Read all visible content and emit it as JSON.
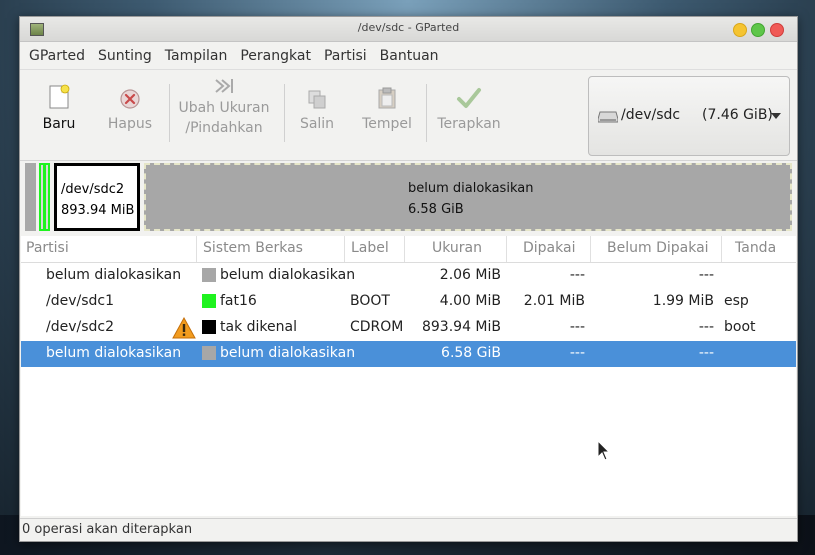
{
  "window": {
    "title": "/dev/sdc - GParted"
  },
  "menu": [
    "GParted",
    "Sunting",
    "Tampilan",
    "Perangkat",
    "Partisi",
    "Bantuan"
  ],
  "toolbar": {
    "new": "Baru",
    "delete": "Hapus",
    "resize_line1": "Ubah Ukuran",
    "resize_line2": "/Pindahkan",
    "copy": "Salin",
    "paste": "Tempel",
    "apply": "Terapkan"
  },
  "device": {
    "name": "/dev/sdc",
    "size": "(7.46 GiB)"
  },
  "diskmap": {
    "sdc2_name": "/dev/sdc2",
    "sdc2_size": "893.94 MiB",
    "unalloc_label": "belum dialokasikan",
    "unalloc_size": "6.58 GiB"
  },
  "columns": [
    "Partisi",
    "Sistem Berkas",
    "Label",
    "Ukuran",
    "Dipakai",
    "Belum Dipakai",
    "Tanda"
  ],
  "rows": [
    {
      "partition": "belum dialokasikan",
      "fs": "belum dialokasikan",
      "fs_color": "#a7a7a7",
      "label": "",
      "size": "2.06 MiB",
      "used": "---",
      "unused": "---",
      "flags": ""
    },
    {
      "partition": "/dev/sdc1",
      "fs": "fat16",
      "fs_color": "#1ff31f",
      "label": "BOOT",
      "size": "4.00 MiB",
      "used": "2.01 MiB",
      "unused": "1.99 MiB",
      "flags": "esp"
    },
    {
      "partition": "/dev/sdc2",
      "fs": "tak dikenal",
      "fs_color": "#000000",
      "label": "CDROM",
      "size": "893.94 MiB",
      "used": "---",
      "unused": "---",
      "flags": "boot"
    },
    {
      "partition": "belum dialokasikan",
      "fs": "belum dialokasikan",
      "fs_color": "#a7a7a7",
      "label": "",
      "size": "6.58 GiB",
      "used": "---",
      "unused": "---",
      "flags": ""
    }
  ],
  "status": "0 operasi akan diterapkan",
  "colors": {
    "selection": "#4a90d9",
    "fat16": "#1ff31f",
    "unallocated": "#a7a7a7"
  }
}
